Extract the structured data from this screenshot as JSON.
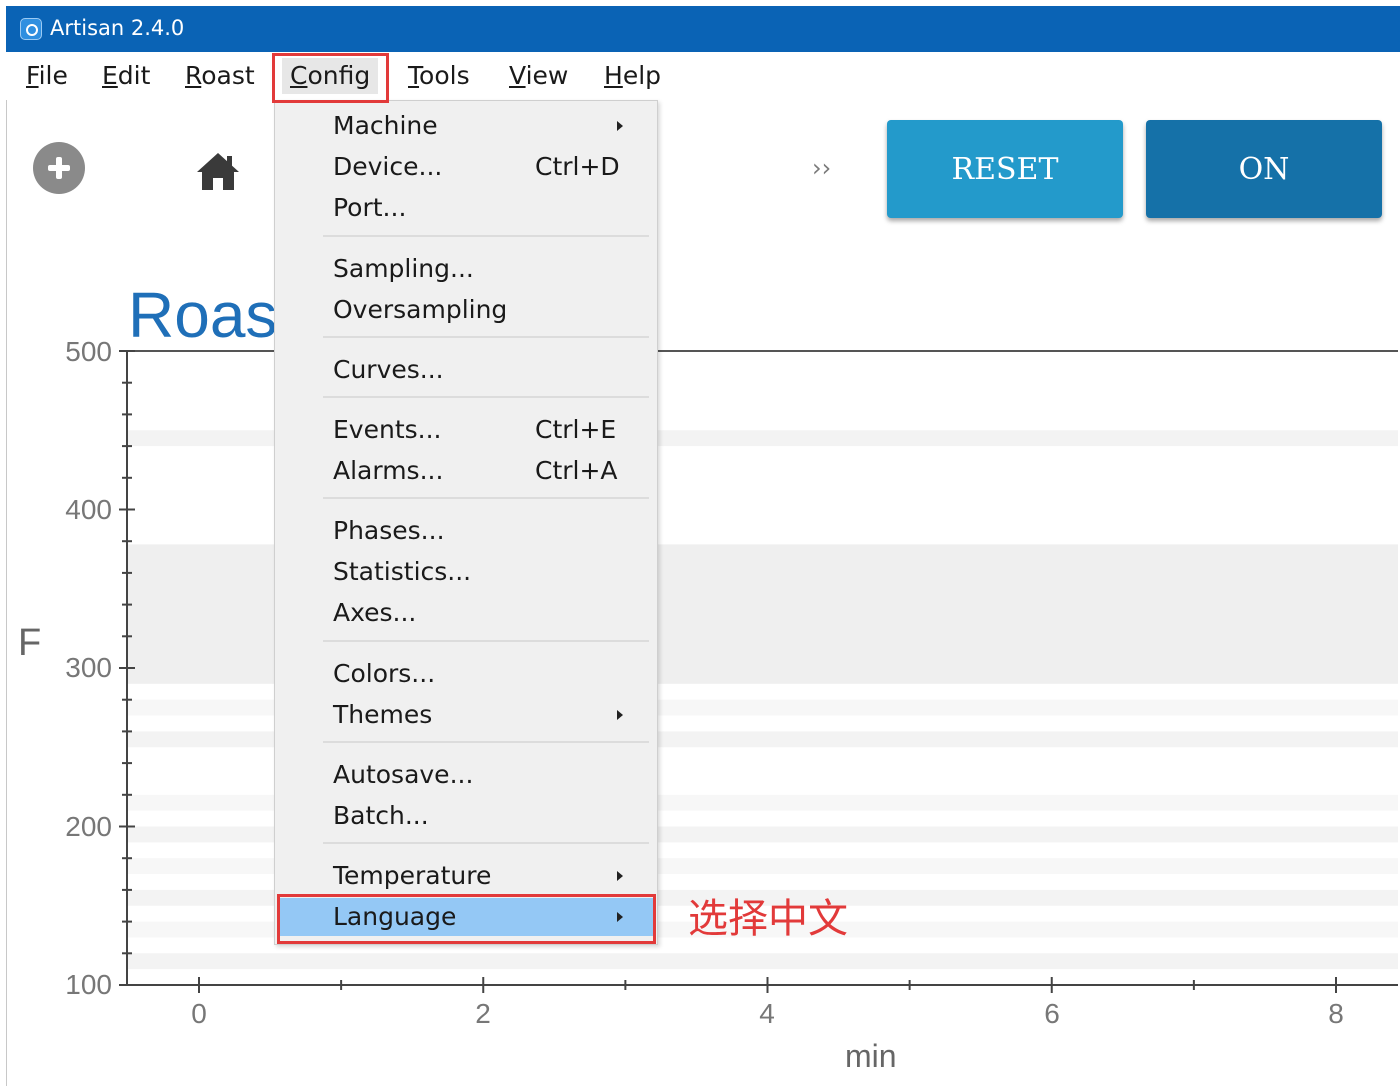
{
  "window": {
    "title": "Artisan 2.4.0"
  },
  "menubar": {
    "items": [
      {
        "label": "File"
      },
      {
        "label": "Edit"
      },
      {
        "label": "Roast"
      },
      {
        "label": "Config"
      },
      {
        "label": "Tools"
      },
      {
        "label": "View"
      },
      {
        "label": "Help"
      }
    ]
  },
  "toolbar": {
    "overflow_label": "››",
    "reset_label": "RESET",
    "on_label": "ON"
  },
  "chart_title": "Roas",
  "config_menu": {
    "items": [
      {
        "label": "Machine",
        "shortcut": "",
        "submenu": true
      },
      {
        "label": "Device...",
        "shortcut": "Ctrl+D",
        "submenu": false
      },
      {
        "label": "Port...",
        "shortcut": "",
        "submenu": false
      },
      {
        "label": "Sampling...",
        "shortcut": "",
        "submenu": false
      },
      {
        "label": "Oversampling",
        "shortcut": "",
        "submenu": false
      },
      {
        "label": "Curves...",
        "shortcut": "",
        "submenu": false
      },
      {
        "label": "Events...",
        "shortcut": "Ctrl+E",
        "submenu": false
      },
      {
        "label": "Alarms...",
        "shortcut": "Ctrl+A",
        "submenu": false
      },
      {
        "label": "Phases...",
        "shortcut": "",
        "submenu": false
      },
      {
        "label": "Statistics...",
        "shortcut": "",
        "submenu": false
      },
      {
        "label": "Axes...",
        "shortcut": "",
        "submenu": false
      },
      {
        "label": "Colors...",
        "shortcut": "",
        "submenu": false
      },
      {
        "label": "Themes",
        "shortcut": "",
        "submenu": true
      },
      {
        "label": "Autosave...",
        "shortcut": "",
        "submenu": false
      },
      {
        "label": "Batch...",
        "shortcut": "",
        "submenu": false
      },
      {
        "label": "Temperature",
        "shortcut": "",
        "submenu": true
      },
      {
        "label": "Language",
        "shortcut": "",
        "submenu": true,
        "highlighted": true
      }
    ]
  },
  "annotation": {
    "text": "选择中文",
    "color": "#e23a3a"
  },
  "colors": {
    "titlebar": "#0a63b5",
    "reset_button": "#239acb",
    "on_button": "#1571a8",
    "highlight": "#94c8f5",
    "title_text": "#1f6fb8"
  },
  "chart_data": {
    "type": "line",
    "xlabel": "min",
    "ylabel": "F",
    "xlim": [
      0,
      8
    ],
    "ylim": [
      100,
      500
    ],
    "xticks": [
      "0",
      "2",
      "4",
      "6",
      "8"
    ],
    "yticks": [
      "500",
      "400",
      "300",
      "200",
      "100"
    ],
    "series": []
  }
}
